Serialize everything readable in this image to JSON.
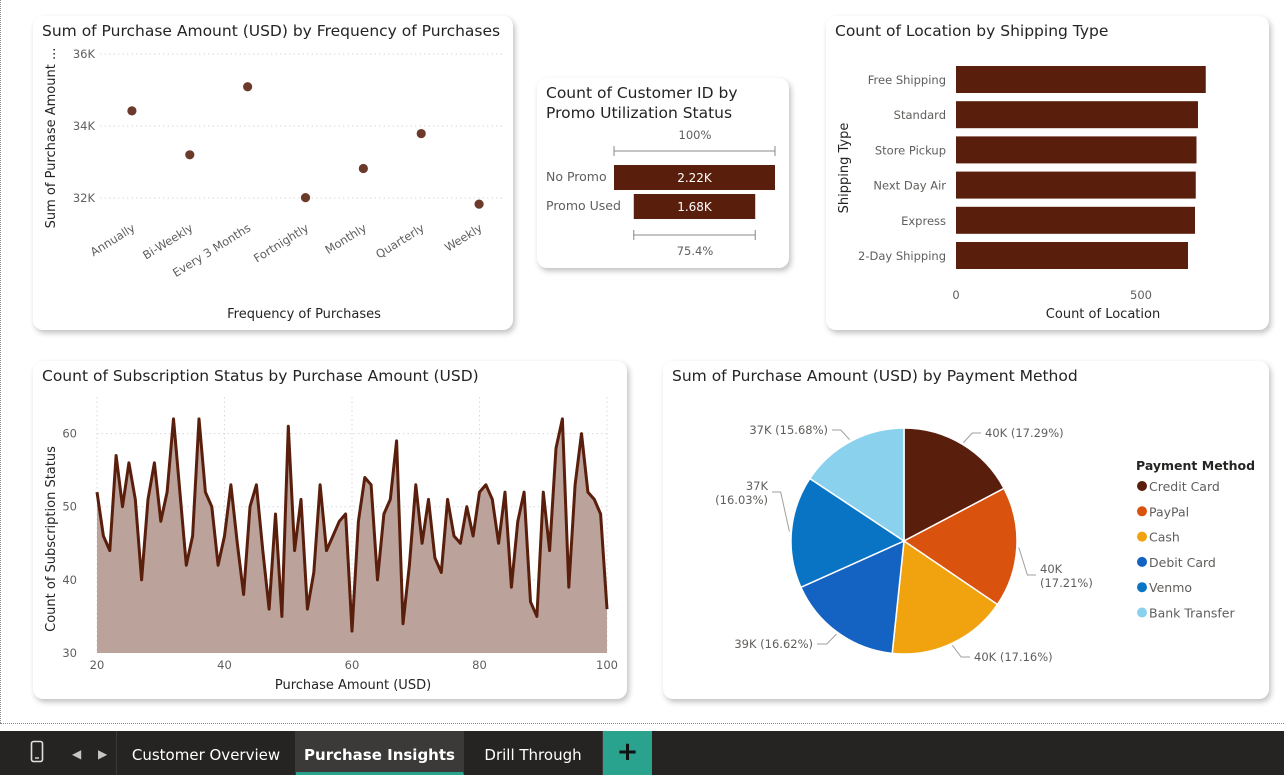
{
  "scatter": {
    "title": "Sum of Purchase Amount (USD) by Frequency of Purchases",
    "chart_data": {
      "type": "scatter",
      "title": "Sum of Purchase Amount (USD) by Frequency of Purchases",
      "xlabel": "Frequency of Purchases",
      "ylabel": "Sum of Purchase Amount ...",
      "categories": [
        "Annually",
        "Bi-Weekly",
        "Every 3 Months",
        "Fortnightly",
        "Monthly",
        "Quarterly",
        "Weekly"
      ],
      "values": [
        34420,
        33200,
        35090,
        32010,
        32820,
        33790,
        31830
      ],
      "yticks": [
        "32K",
        "34K",
        "36K"
      ],
      "ylim": [
        31500,
        36000
      ],
      "color": "#6b3a2a",
      "grid": true
    }
  },
  "promo": {
    "title_line1": "Count of Customer ID by",
    "title_line2": "Promo Utilization Status",
    "top_pct": "100%",
    "bottom_pct": "75.4%",
    "chart_data": {
      "type": "bar",
      "title": "Count of Customer ID by Promo Utilization Status",
      "categories": [
        "No Promo",
        "Promo Used"
      ],
      "values": [
        2223,
        1677
      ],
      "labels": [
        "2.22K",
        "1.68K"
      ],
      "color": "#5a1f0c"
    }
  },
  "shipping": {
    "title": "Count of Location by Shipping Type",
    "chart_data": {
      "type": "bar",
      "orientation": "horizontal",
      "title": "Count of Location by Shipping Type",
      "xlabel": "Count of Location",
      "ylabel": "Shipping Type",
      "categories": [
        "Free Shipping",
        "Standard",
        "Store Pickup",
        "Next Day Air",
        "Express",
        "2-Day Shipping"
      ],
      "values": [
        675,
        654,
        650,
        648,
        646,
        627
      ],
      "xticks": [
        "0",
        "500"
      ],
      "xlim": [
        0,
        700
      ],
      "color": "#5a1f0c"
    }
  },
  "subscription": {
    "title": "Count of Subscription Status by Purchase Amount (USD)",
    "chart_data": {
      "type": "area",
      "title": "Count of Subscription Status by Purchase Amount (USD)",
      "xlabel": "Purchase Amount (USD)",
      "ylabel": "Count of Subscription Status",
      "xlim": [
        20,
        100
      ],
      "ylim": [
        30,
        65
      ],
      "xticks": [
        "20",
        "40",
        "60",
        "80",
        "100"
      ],
      "yticks": [
        "30",
        "40",
        "50",
        "60"
      ],
      "x": [
        20,
        21,
        22,
        23,
        24,
        25,
        26,
        27,
        28,
        29,
        30,
        31,
        32,
        33,
        34,
        35,
        36,
        37,
        38,
        39,
        40,
        41,
        42,
        43,
        44,
        45,
        46,
        47,
        48,
        49,
        50,
        51,
        52,
        53,
        54,
        55,
        56,
        57,
        58,
        59,
        60,
        61,
        62,
        63,
        64,
        65,
        66,
        67,
        68,
        69,
        70,
        71,
        72,
        73,
        74,
        75,
        76,
        77,
        78,
        79,
        80,
        81,
        82,
        83,
        84,
        85,
        86,
        87,
        88,
        89,
        90,
        91,
        92,
        93,
        94,
        95,
        96,
        97,
        98,
        99,
        100
      ],
      "y": [
        52,
        46,
        44,
        57,
        50,
        56,
        51,
        40,
        51,
        56,
        48,
        52,
        62,
        52,
        42,
        46,
        62,
        52,
        50,
        42,
        46,
        53,
        45,
        38,
        50,
        53,
        44,
        36,
        49,
        35,
        61,
        44,
        51,
        36,
        41,
        53,
        44,
        46,
        48,
        49,
        33,
        48,
        54,
        53,
        40,
        49,
        51,
        59,
        34,
        42,
        53,
        45,
        51,
        43,
        41,
        51,
        46,
        45,
        50,
        46,
        52,
        53,
        51,
        45,
        52,
        39,
        48,
        52,
        37,
        35,
        52,
        44,
        58,
        62,
        39,
        53,
        60,
        52,
        51,
        49,
        36
      ],
      "color": "#5a1f0c",
      "fill": "#bba39c"
    }
  },
  "payment": {
    "title": "Sum of Purchase Amount (USD) by Payment Method",
    "legend_title": "Payment Method",
    "chart_data": {
      "type": "pie",
      "title": "Sum of Purchase Amount (USD) by Payment Method",
      "legend_title": "Payment Method",
      "legend_position": "right",
      "categories": [
        "Credit Card",
        "PayPal",
        "Cash",
        "Debit Card",
        "Venmo",
        "Bank Transfer"
      ],
      "values": [
        17.29,
        17.21,
        17.16,
        16.62,
        16.03,
        15.68
      ],
      "labels": [
        "40K (17.29%)",
        "40K|(17.21%)",
        "40K (17.16%)",
        "39K (16.62%)",
        "37K|(16.03%)",
        "37K (15.68%)"
      ],
      "colors": [
        "#5a1f0c",
        "#d9530f",
        "#f0a30f",
        "#1463c2",
        "#0a74c4",
        "#89d1ec"
      ]
    }
  },
  "tabs": {
    "items": [
      "Customer Overview",
      "Purchase Insights",
      "Drill Through"
    ],
    "active": "Purchase Insights",
    "add_label": "+"
  }
}
